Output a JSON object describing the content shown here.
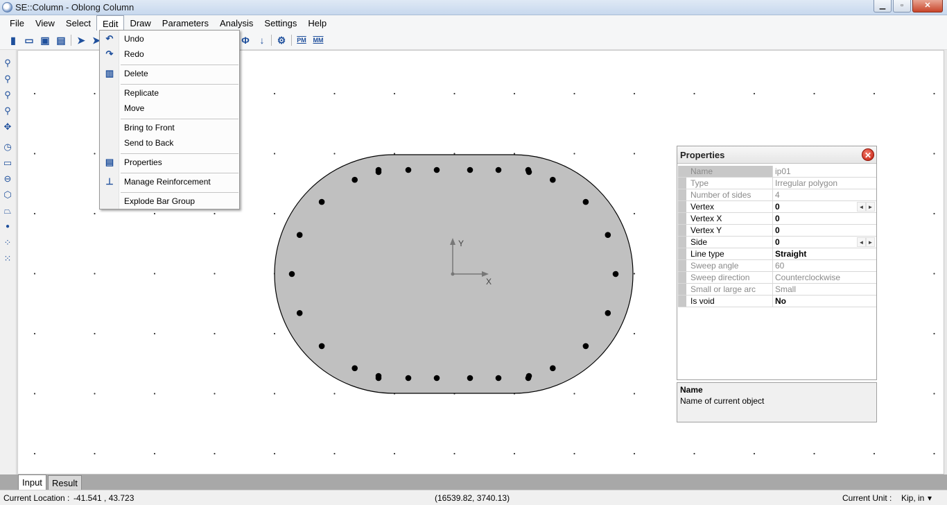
{
  "window": {
    "title": "SE::Column - Oblong Column",
    "minimize": "▁",
    "maximize": "▫",
    "close": "✕"
  },
  "menubar": [
    "File",
    "View",
    "Select",
    "Edit",
    "Draw",
    "Parameters",
    "Analysis",
    "Settings",
    "Help"
  ],
  "toolbar": {
    "icons": [
      "new-icon",
      "open-icon",
      "save-icon",
      "print-icon",
      "select-arrow-icon",
      "select-multi-icon",
      "diameter-icon",
      "down-arrow-icon",
      "gear-icon",
      "pm-icon",
      "mm-icon"
    ],
    "phi_label": "Φ",
    "pm_label": "PM",
    "mm_label": "MM"
  },
  "left_toolbar": [
    "zoom-fit-icon",
    "zoom-in-icon",
    "zoom-out-icon",
    "zoom-window-icon",
    "pan-icon",
    "circle-icon",
    "rectangle-icon",
    "circle-center-icon",
    "polygon-icon",
    "irregular-polygon-icon",
    "bar-icon",
    "bar-circle-icon",
    "bar-grid-icon"
  ],
  "edit_menu": {
    "items": [
      {
        "label": "Undo",
        "icon": "undo-icon"
      },
      {
        "label": "Redo",
        "icon": "redo-icon"
      },
      {
        "label": "Delete",
        "icon": "trash-icon"
      },
      {
        "label": "Replicate",
        "icon": ""
      },
      {
        "label": "Move",
        "icon": ""
      },
      {
        "label": "Bring to Front",
        "icon": ""
      },
      {
        "label": "Send to Back",
        "icon": ""
      },
      {
        "label": "Properties",
        "icon": "properties-icon"
      },
      {
        "label": "Manage Reinforcement",
        "icon": "hierarchy-icon"
      },
      {
        "label": "Explode Bar Group",
        "icon": ""
      }
    ]
  },
  "canvas": {
    "axis_x": "X",
    "axis_y": "Y"
  },
  "properties": {
    "title": "Properties",
    "rows": [
      {
        "name": "Name",
        "value": "ip01",
        "disabled": true,
        "selected": true
      },
      {
        "name": "Type",
        "value": "Irregular polygon",
        "disabled": true
      },
      {
        "name": "Number of sides",
        "value": "4",
        "disabled": true
      },
      {
        "name": "Vertex",
        "value": "0",
        "bold": true,
        "spinner": true
      },
      {
        "name": "Vertex X",
        "value": "0",
        "bold": true
      },
      {
        "name": "Vertex Y",
        "value": "0",
        "bold": true
      },
      {
        "name": "Side",
        "value": "0",
        "bold": true,
        "spinner": true
      },
      {
        "name": "Line type",
        "value": "Straight",
        "bold": true
      },
      {
        "name": "Sweep angle",
        "value": "60",
        "disabled": true
      },
      {
        "name": "Sweep direction",
        "value": "Counterclockwise",
        "disabled": true
      },
      {
        "name": "Small or large arc",
        "value": "Small",
        "disabled": true
      },
      {
        "name": "Is void",
        "value": "No",
        "bold": true
      }
    ],
    "spin_left": "◄",
    "spin_right": "►",
    "desc_title": "Name",
    "desc_text": "Name of current object"
  },
  "tabs": [
    "Input",
    "Result"
  ],
  "status": {
    "location_label": "Current Location :",
    "location_value": "-41.541 , 43.723",
    "coords": "(16539.82, 3740.13)",
    "unit_label": "Current Unit :",
    "unit_value": "Kip, in",
    "unit_arrow": "▾"
  }
}
